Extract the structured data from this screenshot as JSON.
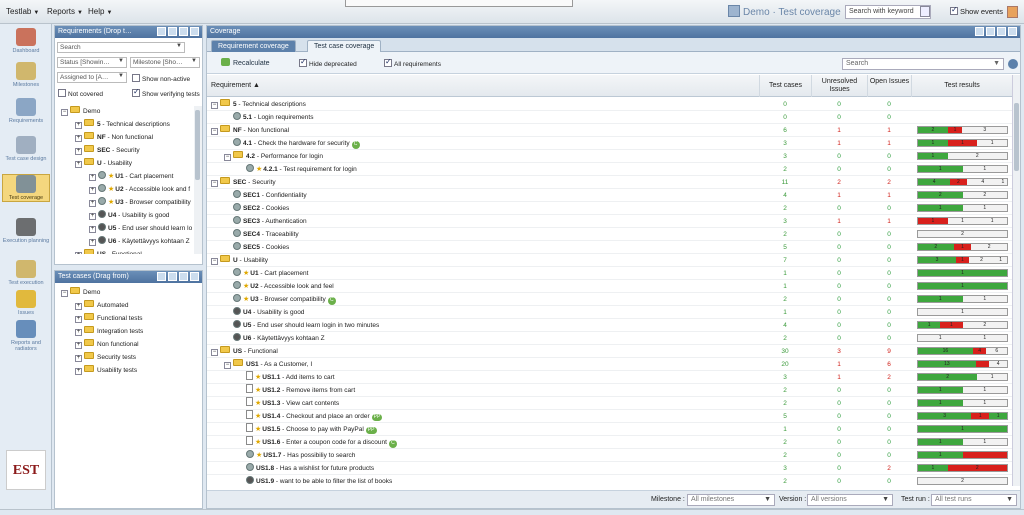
{
  "top_menu": {
    "items": [
      {
        "label": "Testlab"
      },
      {
        "label": "Reports"
      },
      {
        "label": "Help"
      }
    ]
  },
  "brand": {
    "title": "Demo · Test coverage"
  },
  "top_search": {
    "placeholder": "Search with keyword"
  },
  "show_events": {
    "label": "Show events",
    "checked": true
  },
  "nav": [
    {
      "label": "Dashboard",
      "icon": "home-icon",
      "active": false
    },
    {
      "label": "Milestones",
      "icon": "milestone-icon",
      "active": false
    },
    {
      "label": "Requirements",
      "icon": "requirements-icon",
      "active": false
    },
    {
      "label": "Test case design",
      "icon": "test-design-icon",
      "active": false
    },
    {
      "label": "Test coverage",
      "icon": "coverage-icon",
      "active": true
    },
    {
      "label": "Execution planning",
      "icon": "clock-icon",
      "active": false
    },
    {
      "label": "Test execution",
      "icon": "execution-icon",
      "active": false
    },
    {
      "label": "Issues",
      "icon": "warning-icon",
      "active": false
    },
    {
      "label": "Reports and radiators",
      "icon": "chart-icon",
      "active": false
    }
  ],
  "logo_text": "EST",
  "req_panel": {
    "title": "Requirements (Drop t…",
    "search_placeholder": "Search",
    "status": "Status [Showin…",
    "milestone": "Milestone [Sho…",
    "assigned": "Assigned to [A…",
    "show_nonactive": "Show non-active",
    "not_covered": "Not covered",
    "show_verifying": "Show verifying tests",
    "tree": [
      {
        "label": "Demo",
        "level": 0,
        "type": "root"
      },
      {
        "id": "5",
        "label": "Technical descriptions",
        "level": 1,
        "type": "folder"
      },
      {
        "id": "NF",
        "label": "Non functional",
        "level": 1,
        "type": "folder"
      },
      {
        "id": "SEC",
        "label": "Security",
        "level": 1,
        "type": "folder"
      },
      {
        "id": "U",
        "label": "Usability",
        "level": 1,
        "type": "folder"
      },
      {
        "id": "U1",
        "label": "Cart placement",
        "level": 2,
        "type": "req",
        "star": true
      },
      {
        "id": "U2",
        "label": "Accessible look and f",
        "level": 2,
        "type": "req",
        "star": true
      },
      {
        "id": "U3",
        "label": "Browser compatibility",
        "level": 2,
        "type": "req",
        "star": true
      },
      {
        "id": "U4",
        "label": "Usability is good",
        "level": 2,
        "type": "req",
        "star": false
      },
      {
        "id": "U5",
        "label": "End user should learn lo",
        "level": 2,
        "type": "req",
        "star": false
      },
      {
        "id": "U6",
        "label": "Käytettävyys kohtaan Z",
        "level": 2,
        "type": "req",
        "star": false
      },
      {
        "id": "US",
        "label": "Functional",
        "level": 1,
        "type": "folder"
      }
    ]
  },
  "tc_panel": {
    "title": "Test cases (Drag from)",
    "tree": [
      {
        "label": "Demo",
        "level": 0,
        "type": "root"
      },
      {
        "label": "Automated",
        "level": 1,
        "type": "folder"
      },
      {
        "label": "Functional tests",
        "level": 1,
        "type": "folder"
      },
      {
        "label": "Integration tests",
        "level": 1,
        "type": "folder"
      },
      {
        "label": "Non functional",
        "level": 1,
        "type": "folder"
      },
      {
        "label": "Security tests",
        "level": 1,
        "type": "folder"
      },
      {
        "label": "Usability tests",
        "level": 1,
        "type": "folder"
      }
    ]
  },
  "coverage": {
    "title": "Coverage",
    "tabs": [
      {
        "label": "Requirement coverage",
        "active": true
      },
      {
        "label": "Test case coverage",
        "active": false
      }
    ],
    "recalculate": "Recalculate",
    "hide_deprecated": "Hide deprecated",
    "all_requirements": "All requirements",
    "search_placeholder": "Search",
    "columns": {
      "requirement": "Requirement",
      "test_cases": "Test cases",
      "unresolved": "Unresolved Issues",
      "open": "Open Issues",
      "results": "Test results"
    },
    "rows": [
      {
        "lvl": 0,
        "kind": "folder",
        "exp": "-",
        "id": "5",
        "name": "Technical descriptions",
        "tc": "0",
        "un": "0",
        "op": "0",
        "bar": []
      },
      {
        "lvl": 1,
        "kind": "gear",
        "id": "5.1",
        "name": "Login requirements",
        "tc": "0",
        "un": "0",
        "op": "0",
        "bar": []
      },
      {
        "lvl": 0,
        "kind": "folder",
        "exp": "-",
        "id": "NF",
        "name": "Non functional",
        "tc": "6",
        "un": "1",
        "op": "1",
        "bar": [
          {
            "c": "g",
            "v": 2,
            "t": "2"
          },
          {
            "c": "r",
            "v": 1,
            "t": "1"
          },
          {
            "c": "n",
            "v": 3,
            "t": "3"
          }
        ]
      },
      {
        "lvl": 1,
        "kind": "gear",
        "id": "4.1",
        "name": "Check the hardware for security",
        "badge": "C",
        "tc": "3",
        "un": "1",
        "op": "1",
        "bar": [
          {
            "c": "g",
            "v": 1,
            "t": "1"
          },
          {
            "c": "r",
            "v": 1,
            "t": "1"
          },
          {
            "c": "n",
            "v": 1,
            "t": "1"
          }
        ]
      },
      {
        "lvl": 1,
        "kind": "folder",
        "exp": "-",
        "id": "4.2",
        "name": "Performance for login",
        "tc": "3",
        "un": "0",
        "op": "0",
        "bar": [
          {
            "c": "g",
            "v": 1,
            "t": "1"
          },
          {
            "c": "n",
            "v": 2,
            "t": "2"
          }
        ]
      },
      {
        "lvl": 2,
        "kind": "gear",
        "star": true,
        "id": "4.2.1",
        "name": "Test requirement for login",
        "tc": "2",
        "un": "0",
        "op": "0",
        "bar": [
          {
            "c": "g",
            "v": 1,
            "t": "1"
          },
          {
            "c": "n",
            "v": 1,
            "t": "1"
          }
        ]
      },
      {
        "lvl": 0,
        "kind": "folder",
        "exp": "-",
        "id": "SEC",
        "name": "Security",
        "tc": "11",
        "un": "2",
        "op": "2",
        "bar": [
          {
            "c": "g",
            "v": 4,
            "t": "4"
          },
          {
            "c": "r",
            "v": 2,
            "t": "2"
          },
          {
            "c": "n",
            "v": 4,
            "t": "4"
          },
          {
            "c": "n",
            "v": 1,
            "t": "1"
          }
        ]
      },
      {
        "lvl": 1,
        "kind": "gear",
        "id": "SEC1",
        "name": "Confidentiality",
        "tc": "4",
        "un": "1",
        "op": "1",
        "bar": [
          {
            "c": "g",
            "v": 2,
            "t": "2"
          },
          {
            "c": "n",
            "v": 2,
            "t": "2"
          }
        ]
      },
      {
        "lvl": 1,
        "kind": "gear",
        "id": "SEC2",
        "name": "Cookies",
        "tc": "2",
        "un": "0",
        "op": "0",
        "bar": [
          {
            "c": "g",
            "v": 1,
            "t": "1"
          },
          {
            "c": "n",
            "v": 1,
            "t": "1"
          }
        ]
      },
      {
        "lvl": 1,
        "kind": "gear",
        "id": "SEC3",
        "name": "Authentication",
        "tc": "3",
        "un": "1",
        "op": "1",
        "bar": [
          {
            "c": "r",
            "v": 1,
            "t": "1"
          },
          {
            "c": "n",
            "v": 1,
            "t": "1"
          },
          {
            "c": "n",
            "v": 1,
            "t": "1"
          }
        ]
      },
      {
        "lvl": 1,
        "kind": "gear",
        "id": "SEC4",
        "name": "Traceability",
        "tc": "2",
        "un": "0",
        "op": "0",
        "bar": [
          {
            "c": "n",
            "v": 2,
            "t": "2"
          }
        ]
      },
      {
        "lvl": 1,
        "kind": "gear",
        "id": "SEC5",
        "name": "Cookies",
        "tc": "5",
        "un": "0",
        "op": "0",
        "bar": [
          {
            "c": "g",
            "v": 2,
            "t": "2"
          },
          {
            "c": "r",
            "v": 1,
            "t": "1"
          },
          {
            "c": "n",
            "v": 2,
            "t": "2"
          }
        ]
      },
      {
        "lvl": 0,
        "kind": "folder",
        "exp": "-",
        "id": "U",
        "name": "Usability",
        "tc": "7",
        "un": "0",
        "op": "0",
        "bar": [
          {
            "c": "g",
            "v": 3,
            "t": "3"
          },
          {
            "c": "r",
            "v": 1,
            "t": "1"
          },
          {
            "c": "n",
            "v": 2,
            "t": "2"
          },
          {
            "c": "n",
            "v": 1,
            "t": "1"
          }
        ]
      },
      {
        "lvl": 1,
        "kind": "gear",
        "star": true,
        "id": "U1",
        "name": "Cart placement",
        "tc": "1",
        "un": "0",
        "op": "0",
        "bar": [
          {
            "c": "g",
            "v": 1,
            "t": "1"
          }
        ]
      },
      {
        "lvl": 1,
        "kind": "gear",
        "star": true,
        "id": "U2",
        "name": "Accessible look and feel",
        "tc": "1",
        "un": "0",
        "op": "0",
        "bar": [
          {
            "c": "g",
            "v": 1,
            "t": "1"
          }
        ]
      },
      {
        "lvl": 1,
        "kind": "gear",
        "star": true,
        "id": "U3",
        "name": "Browser compatibility",
        "badge": "C",
        "tc": "2",
        "un": "0",
        "op": "0",
        "bar": [
          {
            "c": "g",
            "v": 1,
            "t": "1"
          },
          {
            "c": "n",
            "v": 1,
            "t": "1"
          }
        ]
      },
      {
        "lvl": 1,
        "kind": "dgear",
        "id": "U4",
        "name": "Usability is good",
        "tc": "1",
        "un": "0",
        "op": "0",
        "bar": [
          {
            "c": "n",
            "v": 1,
            "t": "1"
          }
        ]
      },
      {
        "lvl": 1,
        "kind": "dgear",
        "id": "U5",
        "name": "End user should learn login in two minutes",
        "tc": "4",
        "un": "0",
        "op": "0",
        "bar": [
          {
            "c": "g",
            "v": 1,
            "t": "1"
          },
          {
            "c": "r",
            "v": 1,
            "t": "1"
          },
          {
            "c": "n",
            "v": 2,
            "t": "2"
          }
        ]
      },
      {
        "lvl": 1,
        "kind": "dgear",
        "id": "U6",
        "name": "Käytettävyys kohtaan Z",
        "tc": "2",
        "un": "0",
        "op": "0",
        "bar": [
          {
            "c": "n",
            "v": 1,
            "t": "1"
          },
          {
            "c": "n",
            "v": 1,
            "t": "1"
          }
        ]
      },
      {
        "lvl": 0,
        "kind": "folder",
        "exp": "-",
        "id": "US",
        "name": "Functional",
        "tc": "30",
        "un": "3",
        "op": "9",
        "bar": [
          {
            "c": "g",
            "v": 16,
            "t": "16"
          },
          {
            "c": "r",
            "v": 4,
            "t": "4"
          },
          {
            "c": "n",
            "v": 6,
            "t": "6"
          }
        ]
      },
      {
        "lvl": 1,
        "kind": "folder",
        "exp": "-",
        "id": "US1",
        "name": "As a Customer, I",
        "tc": "20",
        "un": "1",
        "op": "6",
        "bar": [
          {
            "c": "g",
            "v": 13,
            "t": "13"
          },
          {
            "c": "r",
            "v": 3,
            "t": ""
          },
          {
            "c": "n",
            "v": 4,
            "t": "4"
          }
        ]
      },
      {
        "lvl": 2,
        "kind": "doc",
        "star": true,
        "id": "US1.1",
        "name": "Add items to cart",
        "tc": "3",
        "un": "1",
        "op": "2",
        "bar": [
          {
            "c": "g",
            "v": 2,
            "t": "2"
          },
          {
            "c": "n",
            "v": 1,
            "t": "1"
          }
        ]
      },
      {
        "lvl": 2,
        "kind": "doc",
        "star": true,
        "id": "US1.2",
        "name": "Remove items from cart",
        "tc": "2",
        "un": "0",
        "op": "0",
        "bar": [
          {
            "c": "g",
            "v": 1,
            "t": "1"
          },
          {
            "c": "n",
            "v": 1,
            "t": "1"
          }
        ]
      },
      {
        "lvl": 2,
        "kind": "doc",
        "star": true,
        "id": "US1.3",
        "name": "View cart contents",
        "tc": "2",
        "un": "0",
        "op": "0",
        "bar": [
          {
            "c": "g",
            "v": 1,
            "t": "1"
          },
          {
            "c": "n",
            "v": 1,
            "t": "1"
          }
        ]
      },
      {
        "lvl": 2,
        "kind": "doc",
        "star": true,
        "id": "US1.4",
        "name": "Checkout and place an order",
        "badge": "PP",
        "tc": "5",
        "un": "0",
        "op": "0",
        "bar": [
          {
            "c": "g",
            "v": 3,
            "t": "3"
          },
          {
            "c": "r",
            "v": 1,
            "t": "1"
          },
          {
            "c": "g",
            "v": 1,
            "t": "1"
          }
        ]
      },
      {
        "lvl": 2,
        "kind": "doc",
        "star": true,
        "id": "US1.5",
        "name": "Choose to pay with PayPal",
        "badge": "PP",
        "tc": "1",
        "un": "0",
        "op": "0",
        "bar": [
          {
            "c": "g",
            "v": 1,
            "t": "1"
          }
        ]
      },
      {
        "lvl": 2,
        "kind": "doc",
        "star": true,
        "id": "US1.6",
        "name": "Enter a coupon code for a discount",
        "badge": "C",
        "tc": "2",
        "un": "0",
        "op": "0",
        "bar": [
          {
            "c": "g",
            "v": 1,
            "t": "1"
          },
          {
            "c": "n",
            "v": 1,
            "t": "1"
          }
        ]
      },
      {
        "lvl": 2,
        "kind": "gear",
        "star": true,
        "id": "US1.7",
        "name": "Has possibiliy to search",
        "tc": "2",
        "un": "0",
        "op": "0",
        "bar": [
          {
            "c": "g",
            "v": 1,
            "t": "1"
          },
          {
            "c": "r",
            "v": 1,
            "t": ""
          }
        ]
      },
      {
        "lvl": 2,
        "kind": "gear",
        "id": "US1.8",
        "name": "Has a wishlist for future products",
        "tc": "3",
        "un": "0",
        "op": "2",
        "bar": [
          {
            "c": "g",
            "v": 1,
            "t": "1"
          },
          {
            "c": "r",
            "v": 2,
            "t": "2"
          }
        ]
      },
      {
        "lvl": 2,
        "kind": "dgear",
        "id": "US1.9",
        "name": "want to be able to filter the list of books",
        "tc": "2",
        "un": "0",
        "op": "0",
        "bar": [
          {
            "c": "n",
            "v": 2,
            "t": "2"
          }
        ]
      }
    ],
    "footer": {
      "milestone_label": "Milestone :",
      "milestone_value": "All milestones",
      "version_label": "Version :",
      "version_value": "All versions",
      "testrun_label": "Test run :",
      "testrun_value": "All test runs"
    }
  },
  "colors": {
    "pass": "#3ea73e",
    "fail": "#d8201c",
    "notrun": "#f2f2f2"
  }
}
